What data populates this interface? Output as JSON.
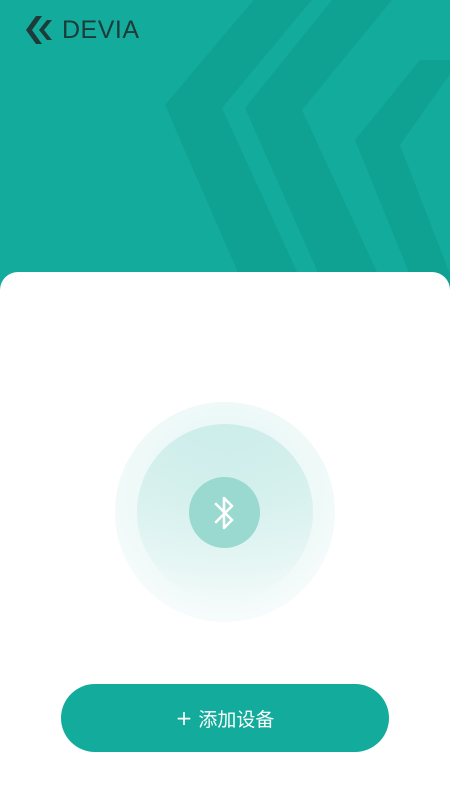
{
  "brand": {
    "name": "DEVIA",
    "logo_icon": "devia-chevron-logo"
  },
  "main": {
    "bluetooth_icon": "bluetooth-icon"
  },
  "add_device": {
    "plus": "+",
    "label": "添加设备"
  },
  "colors": {
    "primary": "#12ab9c",
    "primary_dark": "#0fa293",
    "bluetooth_bg": "#9ad9d0",
    "brand_text": "#1d3b39"
  }
}
